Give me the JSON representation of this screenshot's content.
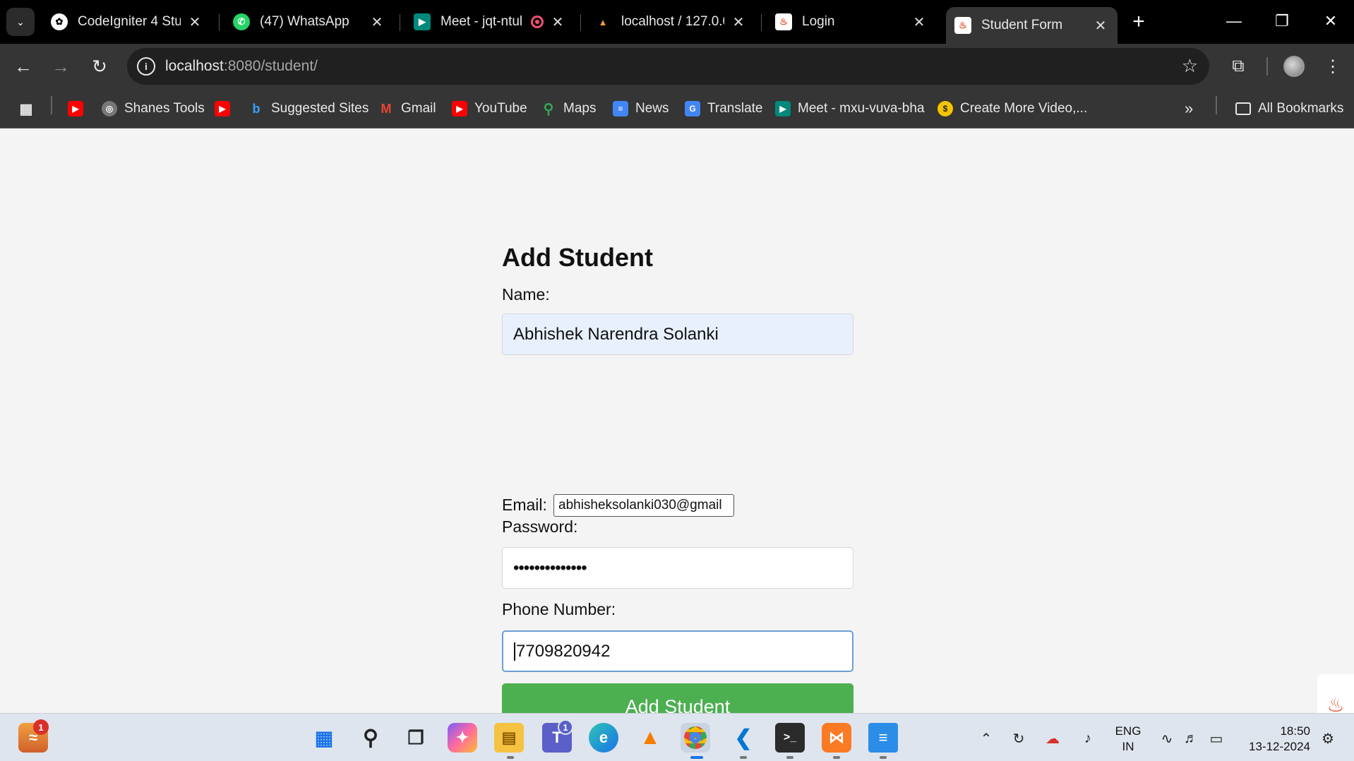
{
  "browser": {
    "tabs": [
      {
        "title": "CodeIgniter 4 Stud",
        "icon": "openai-icon",
        "active": false
      },
      {
        "title": "(47) WhatsApp",
        "icon": "whatsapp-icon",
        "active": false
      },
      {
        "title": "Meet - jqt-ntul",
        "icon": "google-meet-icon",
        "active": false
      },
      {
        "title": "localhost / 127.0.0.",
        "icon": "phpmyadmin-icon",
        "active": false
      },
      {
        "title": "Login",
        "icon": "codeigniter-icon",
        "active": false
      },
      {
        "title": "Student Form",
        "icon": "codeigniter-icon",
        "active": true
      }
    ],
    "new_tab_glyph": "+",
    "address_bar": {
      "host": "localhost",
      "path": ":8080/student/"
    },
    "bookmarks": [
      {
        "label": "",
        "icon": "youtube-icon"
      },
      {
        "label": "Shanes Tools",
        "icon": "globe-icon"
      },
      {
        "label": "",
        "icon": "youtube-icon"
      },
      {
        "label": "Suggested Sites",
        "icon": "bing-icon"
      },
      {
        "label": "Gmail",
        "icon": "gmail-icon"
      },
      {
        "label": "YouTube",
        "icon": "youtube-icon"
      },
      {
        "label": "Maps",
        "icon": "maps-icon"
      },
      {
        "label": "News",
        "icon": "news-icon"
      },
      {
        "label": "Translate",
        "icon": "translate-icon"
      },
      {
        "label": "Meet - mxu-vuva-bha",
        "icon": "google-meet-icon"
      },
      {
        "label": "Create More Video,...",
        "icon": "dollar-icon"
      }
    ],
    "all_bookmarks_label": "All Bookmarks"
  },
  "form": {
    "title": "Add Student",
    "name_label": "Name:",
    "name_value": "Abhishek Narendra Solanki",
    "email_label": "Email:",
    "email_value": "abhisheksolanki030@gmail",
    "password_label": "Password:",
    "password_mask": "••••••••••••••",
    "phone_label": "Phone Number:",
    "phone_value": "7709820942",
    "submit_label": "Add Student"
  },
  "taskbar": {
    "notification_badge": "1",
    "teams_badge": "1",
    "language_line1": "ENG",
    "language_line2": "IN",
    "time": "18:50",
    "date": "13-12-2024"
  },
  "colors": {
    "submit_button": "#4caf50",
    "autofill_bg": "#e8f0fe",
    "page_bg": "#f4f4f4",
    "browser_chrome": "#353535"
  }
}
